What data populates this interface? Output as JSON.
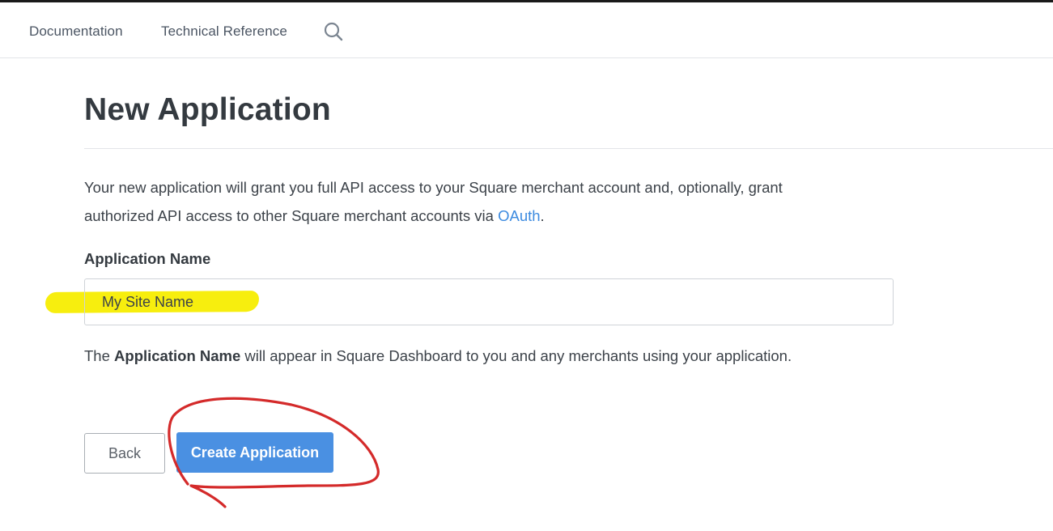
{
  "nav": {
    "documentation": "Documentation",
    "technical_reference": "Technical Reference",
    "search_icon": "search-icon"
  },
  "page": {
    "title": "New Application",
    "intro_before_link": "Your new application will grant you full API access to your Square merchant account and, optionally, grant authorized API access to other Square merchant accounts via ",
    "intro_link": "OAuth",
    "intro_after_link": "."
  },
  "form": {
    "label": "Application Name",
    "value": "My Site Name",
    "help_bold": "Application Name",
    "help_before": "The ",
    "help_after": " will appear in Square Dashboard to you and any merchants using your application."
  },
  "buttons": {
    "back": "Back",
    "create": "Create Application"
  },
  "colors": {
    "accent": "#4a90e2",
    "link": "#3d8be0",
    "highlight": "#f7ee0e",
    "annotation": "#d42a2a"
  }
}
